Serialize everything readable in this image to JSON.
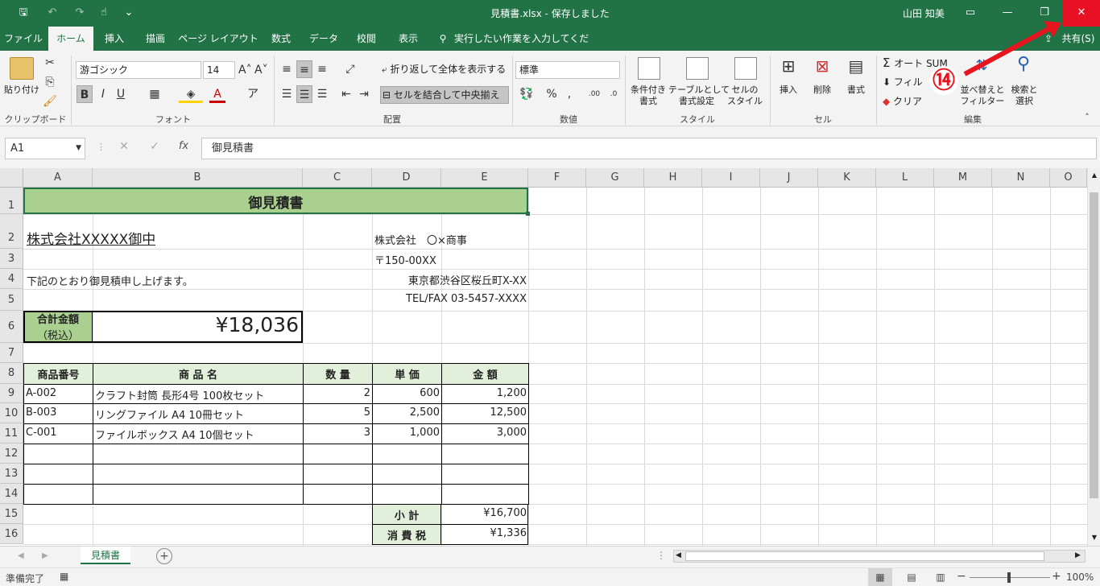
{
  "window": {
    "title": "見積書.xlsx  -  保存しました",
    "user": "山田 知美"
  },
  "qat": {
    "save": "🖫",
    "undo": "↶",
    "redo": "↷",
    "touch": "☝",
    "more": "⌄"
  },
  "tabs": [
    "ファイル",
    "ホーム",
    "挿入",
    "描画",
    "ページ レイアウト",
    "数式",
    "データ",
    "校閲",
    "表示"
  ],
  "tell_me": "実行したい作業を入力してください",
  "share": "共有(S)",
  "ribbon": {
    "clipboard": {
      "paste": "貼り付け",
      "label": "クリップボード"
    },
    "font": {
      "name": "游ゴシック",
      "size": "14",
      "bold": "B",
      "italic": "I",
      "underline": "U",
      "label": "フォント"
    },
    "alignment": {
      "wrap": "折り返して全体を表示する",
      "merge": "セルを結合して中央揃え",
      "label": "配置"
    },
    "number": {
      "format": "標準",
      "label": "数値"
    },
    "styles": {
      "cond": "条件付き\n書式",
      "table": "テーブルとして\n書式設定",
      "cell": "セルの\nスタイル",
      "label": "スタイル"
    },
    "cells": {
      "insert": "挿入",
      "delete": "削除",
      "format": "書式",
      "label": "セル"
    },
    "editing": {
      "autosum": "オート SUM",
      "fill": "フィル",
      "clear": "クリア",
      "sort": "並べ替えと\nフィルター",
      "find": "検索と\n選択",
      "label": "編集"
    }
  },
  "annotation": {
    "badge": "⑭"
  },
  "formula": {
    "name": "A1",
    "content": "御見積書",
    "cancel": "✕",
    "enter": "✓",
    "fx": "fx"
  },
  "columns": [
    "A",
    "B",
    "C",
    "D",
    "E",
    "F",
    "G",
    "H",
    "I",
    "J",
    "K",
    "L",
    "M",
    "N",
    "O"
  ],
  "rows": [
    "1",
    "2",
    "3",
    "4",
    "5",
    "6",
    "7",
    "8",
    "9",
    "10",
    "11",
    "12",
    "13",
    "14",
    "15",
    "16"
  ],
  "sheet": {
    "title": "御見積書",
    "client": "株式会社XXXXX御中",
    "company": "株式会社　〇×商事",
    "zip": "〒150-00XX",
    "address": "東京都渋谷区桜丘町X-XX",
    "tel": "TEL/FAX 03-5457-XXXX",
    "greeting": "下記のとおり御見積申し上げます。",
    "total_label_1": "合計金額",
    "total_label_2": "（税込）",
    "total_value": "¥18,036",
    "headers": [
      "商品番号",
      "商 品 名",
      "数 量",
      "単 価",
      "金 額"
    ],
    "items": [
      [
        "A-002",
        "クラフト封筒 長形4号 100枚セット",
        "2",
        "600",
        "1,200"
      ],
      [
        "B-003",
        "リングファイル A4 10冊セット",
        "5",
        "2,500",
        "12,500"
      ],
      [
        "C-001",
        "ファイルボックス A4 10個セット",
        "3",
        "1,000",
        "3,000"
      ]
    ],
    "subtotal_label": "小 計",
    "subtotal": "¥16,700",
    "tax_label": "消 費 税",
    "tax": "¥1,336"
  },
  "sheet_tab": "見積書",
  "status": {
    "ready": "準備完了",
    "zoom": "100%"
  },
  "colors": {
    "excel_green": "#217346",
    "header_fill": "#a9d08e",
    "light_fill": "#e2efda",
    "close_red": "#e81123",
    "arrow_red": "#e8141e"
  }
}
